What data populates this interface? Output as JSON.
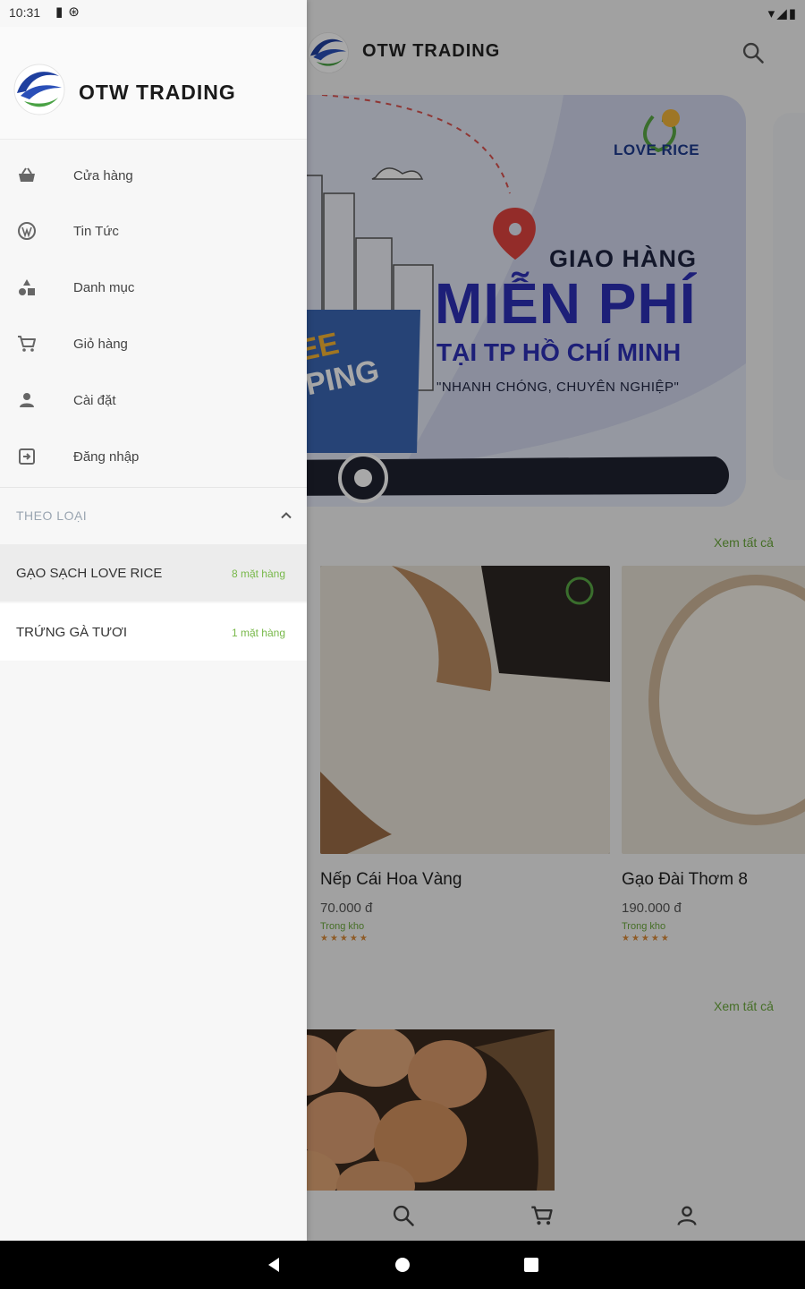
{
  "status_bar": {
    "time": "10:31"
  },
  "app": {
    "title": "OTW TRADING",
    "banner": {
      "brand": "LOVE RICE",
      "line1": "GIAO HÀNG",
      "line2": "MIỄN PHÍ",
      "line3": "TẠI TP HỒ CHÍ MINH",
      "line4": "\"NHANH CHÓNG, CHUYÊN NGHIỆP\"",
      "shipping_a": "EE",
      "shipping_b": "PING"
    },
    "see_all_1": "Xem tất cả",
    "see_all_2": "Xem tất cả",
    "products": [
      {
        "name": "Nếp Cái Hoa Vàng",
        "price": "70.000 đ",
        "stock": "Trong kho",
        "rating": "★★★★★"
      },
      {
        "name": "Gạo Đài Thơm 8",
        "price": "190.000 đ",
        "stock": "Trong kho",
        "rating": "★★★★★"
      }
    ]
  },
  "drawer": {
    "brand": "OTW TRADING",
    "menu": [
      {
        "label": "Cửa hàng",
        "icon": "basket-icon"
      },
      {
        "label": "Tin Tức",
        "icon": "wordpress-icon"
      },
      {
        "label": "Danh mục",
        "icon": "category-icon"
      },
      {
        "label": "Giỏ hàng",
        "icon": "cart-icon"
      },
      {
        "label": "Cài đặt",
        "icon": "person-icon"
      },
      {
        "label": "Đăng nhập",
        "icon": "login-icon"
      }
    ],
    "section_title": "THEO LOẠI",
    "categories": [
      {
        "name": "GẠO SẠCH LOVE RICE",
        "count": "8 mặt hàng"
      },
      {
        "name": "TRỨNG GÀ TƯƠI",
        "count": "1 mặt hàng"
      }
    ]
  },
  "colors": {
    "accent_green": "#6aa83b",
    "banner_blue": "#2d2fb7",
    "brand_navy": "#1d3b8e"
  }
}
